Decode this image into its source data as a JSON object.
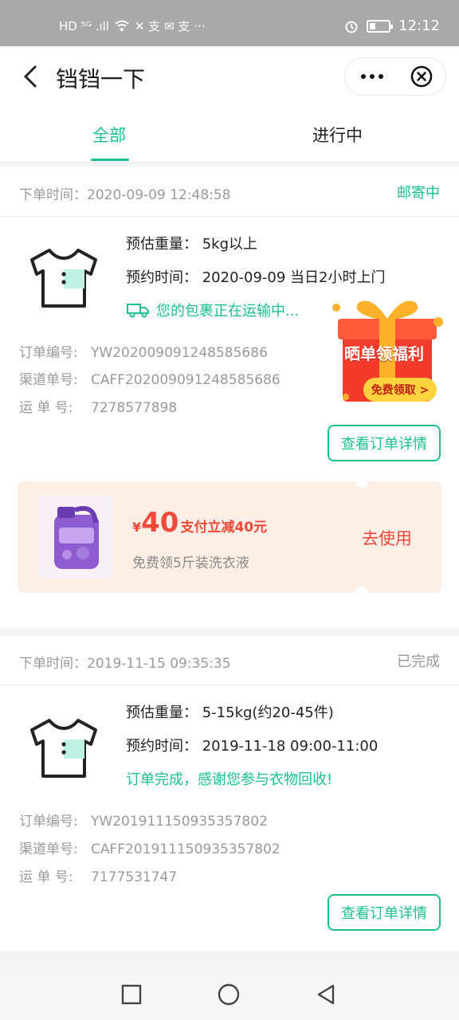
{
  "status_bar": {
    "left_text": "HD ⁵ᴳ .ıll",
    "time": "12:12"
  },
  "header": {
    "title": "铛铛一下",
    "back_icon": "chevron-left-icon",
    "more_icon": "more-dots-icon",
    "close_icon": "close-circle-icon"
  },
  "tabs": [
    {
      "label": "全部",
      "active": true
    },
    {
      "label": "进行中",
      "active": false
    }
  ],
  "orders": [
    {
      "order_time": "下单时间：2020-09-09 12:48:58",
      "status": "邮寄中",
      "weight": "预估重量：  5kg以上",
      "appointment": "预约时间：  2020-09-09 当日2小时上门",
      "progress": "您的包裹正在运输中...",
      "order_no_label": "订单编号:",
      "order_no": "YW202009091248585686",
      "channel_no_label": "渠道单号:",
      "channel_no": "CAFF202009091248585686",
      "waybill_label": "运  单  号:",
      "waybill_no": "7278577898",
      "detail_button": "查看订单详情"
    },
    {
      "order_time": "下单时间：2019-11-15 09:35:35",
      "status": "已完成",
      "weight": "预估重量：  5-15kg(约20-45件)",
      "appointment": "预约时间：  2019-11-18 09:00-11:00",
      "progress": "订单完成，感谢您参与衣物回收!",
      "order_no_label": "订单编号:",
      "order_no": "YW201911150935357802",
      "channel_no_label": "渠道单号:",
      "channel_no": "CAFF201911150935357802",
      "waybill_label": "运  单  号:",
      "waybill_no": "7177531747",
      "detail_button": "查看订单详情"
    }
  ],
  "gift_badge": {
    "title": "晒单领福利",
    "button": "免费领取 >"
  },
  "promo": {
    "currency": "¥",
    "amount": "40",
    "desc": "支付立减40元",
    "subtitle": "免费领5斤装洗衣液",
    "action": "去使用"
  },
  "colors": {
    "accent": "#1cbf93",
    "promo_red": "#f04a3a"
  }
}
